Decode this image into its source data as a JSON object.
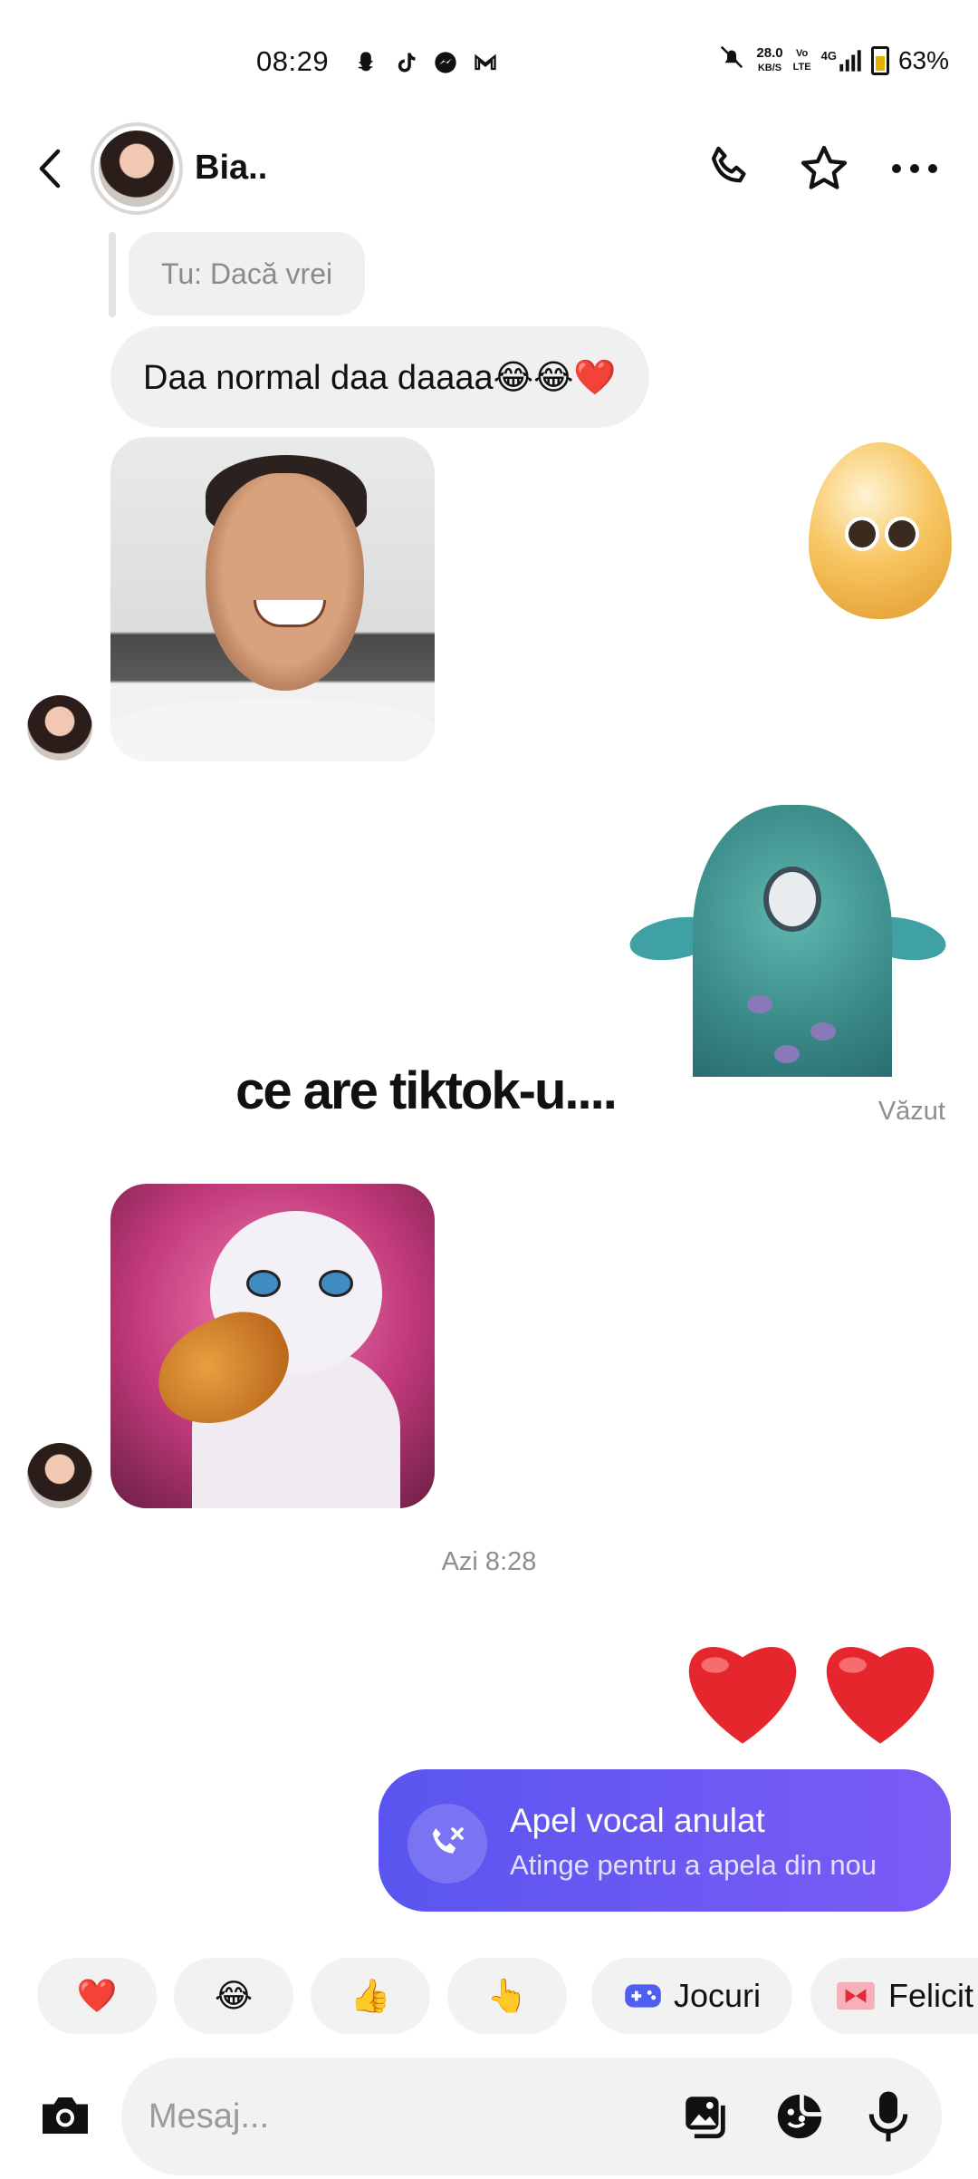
{
  "status_bar": {
    "time": "08:29",
    "app_icons": [
      "snapchat-icon",
      "tiktok-icon",
      "messenger-icon",
      "gmail-icon"
    ],
    "net_speed_value": "28.0",
    "net_speed_unit": "KB/S",
    "volte": "Vo LTE",
    "network": "4G",
    "battery": "63%"
  },
  "header": {
    "contact_name": "Bia..",
    "actions": [
      "phone-icon",
      "star-icon",
      "more-icon"
    ]
  },
  "messages": {
    "reply_preview": "Tu: Dacă vrei",
    "text_message": "Daa normal daa daaaa😂😂❤️",
    "video_caption": "ce are tiktok-u....",
    "seen_label": "Văzut",
    "timestamp": "Azi 8:28",
    "hearts": "❤️❤️",
    "call_card": {
      "title": "Apel vocal anulat",
      "subtitle": "Atinge pentru a apela din nou"
    }
  },
  "quick_replies": [
    {
      "emoji": "❤️"
    },
    {
      "emoji": "😂"
    },
    {
      "emoji": "👍"
    },
    {
      "emoji": "👆"
    },
    {
      "label": "Jocuri",
      "icon": "gamepad-icon"
    },
    {
      "label": "Felicit",
      "icon": "gift-icon"
    }
  ],
  "composer": {
    "placeholder": "Mesaj..."
  },
  "colors": {
    "accent": "#6a58f3",
    "bubble_gray": "#f0f0f0",
    "heart_red": "#e5262d"
  }
}
